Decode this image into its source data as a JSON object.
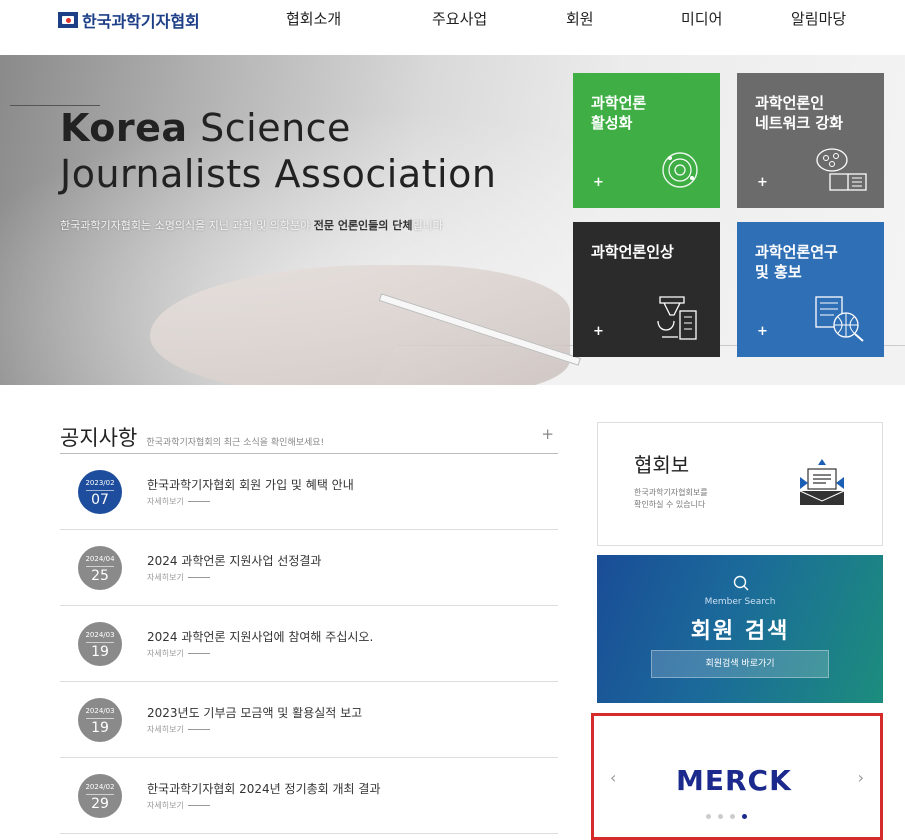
{
  "header": {
    "logo_text": "한국과학기자협회",
    "nav": [
      "협회소개",
      "주요사업",
      "회원",
      "미디어",
      "알림마당"
    ]
  },
  "hero": {
    "title_bold": "Korea",
    "title_rest": " Science",
    "title_line2": "Journalists Association",
    "subtitle_pre": "한국과학기자협회는 소명의식을 지닌 과학 및 의학분야 ",
    "subtitle_bold": "전문 언론인들의 단체",
    "subtitle_post": "입니다"
  },
  "tiles": [
    {
      "title": "과학언론\n활성화",
      "plus": "+",
      "icon": "orbit-icon",
      "color": "#3fae45"
    },
    {
      "title": "과학언론인\n네트워크 강화",
      "plus": "+",
      "icon": "network-book-icon",
      "color": "#6b6b6b"
    },
    {
      "title": "과학언론인상",
      "plus": "+",
      "icon": "trophy-icon",
      "color": "#2b2b2b"
    },
    {
      "title": "과학언론연구\n및 홍보",
      "plus": "+",
      "icon": "research-globe-icon",
      "color": "#2f6fb6"
    }
  ],
  "notices": {
    "title": "공지사항",
    "desc": "한국과학기자협회의 최근 소식을 확인해보세요!",
    "plus": "+",
    "more_label": "자세히보기",
    "items": [
      {
        "ym": "2023/02",
        "day": "07",
        "text": "한국과학기자협회 회원 가입 및 혜택 안내"
      },
      {
        "ym": "2024/04",
        "day": "25",
        "text": "2024 과학언론 지원사업 선정결과"
      },
      {
        "ym": "2024/03",
        "day": "19",
        "text": "2024 과학언론 지원사업에 참여해 주십시오."
      },
      {
        "ym": "2024/03",
        "day": "19",
        "text": "2023년도 기부금 모금액 및 활용실적 보고"
      },
      {
        "ym": "2024/02",
        "day": "29",
        "text": "한국과학기자협회 2024년 정기총회 개최 결과"
      }
    ]
  },
  "newsletter": {
    "title": "협회보",
    "desc": "한국과학기자협회보를\n확인하실 수 있습니다"
  },
  "member_search": {
    "en": "Member Search",
    "ko": "회원 검색",
    "button": "회원검색 바로가기"
  },
  "banner": {
    "logo": "MERCK",
    "prev": "‹",
    "next": "›",
    "dot_count": 4,
    "active_dot": 3
  },
  "colors": {
    "brand": "#1d3f87",
    "banner_border": "#d62b2b",
    "active_date": "#1d4d9c",
    "inactive_date": "#8a8a8a"
  }
}
